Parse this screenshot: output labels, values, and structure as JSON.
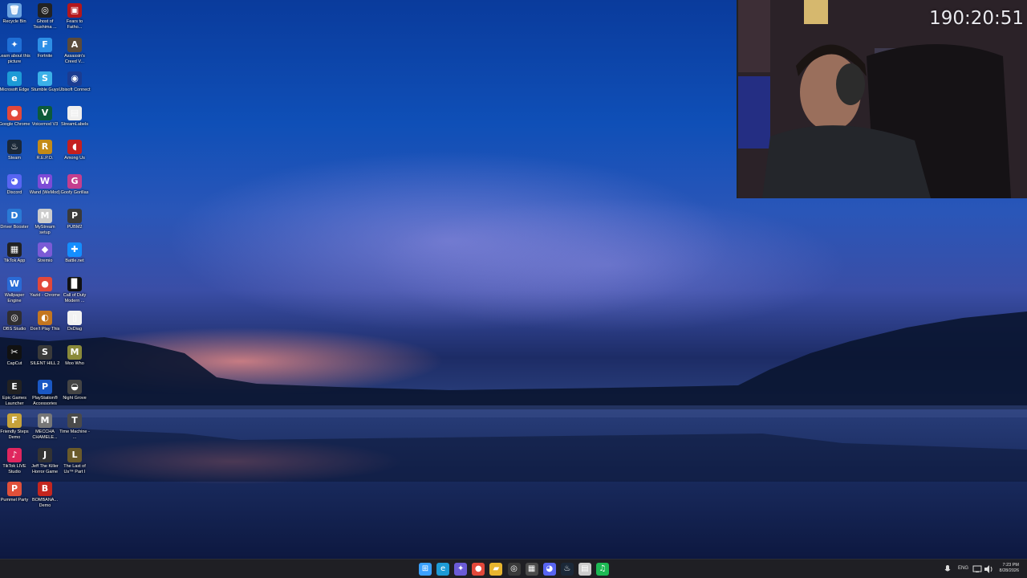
{
  "desktop": {
    "icons": [
      {
        "label": "Recycle Bin",
        "glyph": "🗑",
        "color": "#6aa3e0"
      },
      {
        "label": "Ghost of Tsushima ...",
        "glyph": "◎",
        "color": "#222222"
      },
      {
        "label": "Fears to Fatho...",
        "glyph": "▣",
        "color": "#b3171c"
      },
      {
        "label": "Learn about this picture",
        "glyph": "✦",
        "color": "#1f6fd6"
      },
      {
        "label": "Fortnite",
        "glyph": "F",
        "color": "#2d8fe6"
      },
      {
        "label": "Assassin's Creed V...",
        "glyph": "A",
        "color": "#5a4a3a"
      },
      {
        "label": "Microsoft Edge",
        "glyph": "e",
        "color": "#1d9bd6"
      },
      {
        "label": "Stumble Guys",
        "glyph": "S",
        "color": "#3bb1e8"
      },
      {
        "label": "Ubisoft Connect",
        "glyph": "◉",
        "color": "#1b3c91"
      },
      {
        "label": "Google Chrome",
        "glyph": "●",
        "color": "#e2483a"
      },
      {
        "label": "Voicemod V3",
        "glyph": "V",
        "color": "#0c5a3a"
      },
      {
        "label": "StreamLabels",
        "glyph": "▤",
        "color": "#eeeeee"
      },
      {
        "label": "Steam",
        "glyph": "♨",
        "color": "#1b2838"
      },
      {
        "label": "R.E.P.O.",
        "glyph": "R",
        "color": "#c38a17"
      },
      {
        "label": "Among Us",
        "glyph": "◖",
        "color": "#c41f1f"
      },
      {
        "label": "Discord",
        "glyph": "◕",
        "color": "#5865f2"
      },
      {
        "label": "Wand (WeMod)",
        "glyph": "W",
        "color": "#7d4bd6"
      },
      {
        "label": "Goofy Gorillas",
        "glyph": "G",
        "color": "#c43e8e"
      },
      {
        "label": "Driver Booster",
        "glyph": "D",
        "color": "#2a7ad6"
      },
      {
        "label": "MyStream setup",
        "glyph": "M",
        "color": "#cccccc"
      },
      {
        "label": "PUBM2",
        "glyph": "P",
        "color": "#3a3a3a"
      },
      {
        "label": "TikTok App",
        "glyph": "▦",
        "color": "#222222"
      },
      {
        "label": "Stremio",
        "glyph": "◆",
        "color": "#7b5bd6"
      },
      {
        "label": "Battle.net",
        "glyph": "✚",
        "color": "#148eff"
      },
      {
        "label": "Wallpaper Engine",
        "glyph": "W",
        "color": "#2a6bd6"
      },
      {
        "label": "Yazid - Chrome",
        "glyph": "●",
        "color": "#e2483a"
      },
      {
        "label": "Call of Duty Modern ...",
        "glyph": "▉",
        "color": "#111111"
      },
      {
        "label": "OBS Studio",
        "glyph": "◎",
        "color": "#302e31"
      },
      {
        "label": "Don't Play This",
        "glyph": "◐",
        "color": "#c4761f"
      },
      {
        "label": "DxDiag",
        "glyph": "▯",
        "color": "#f2f2f2"
      },
      {
        "label": "CapCut",
        "glyph": "✂",
        "color": "#111111"
      },
      {
        "label": "SILENT HILL 2",
        "glyph": "S",
        "color": "#3a3a3a"
      },
      {
        "label": "Moo Who",
        "glyph": "M",
        "color": "#8a8a3a"
      },
      {
        "label": "Epic Games Launcher",
        "glyph": "E",
        "color": "#222222"
      },
      {
        "label": "PlayStation® Accessories",
        "glyph": "P",
        "color": "#1a58c4"
      },
      {
        "label": "Night Grove",
        "glyph": "◒",
        "color": "#444444"
      },
      {
        "label": "Friendly Steps Demo",
        "glyph": "F",
        "color": "#c6a23a"
      },
      {
        "label": "MECCHA CHAMELE...",
        "glyph": "M",
        "color": "#777777"
      },
      {
        "label": "Time Machine - ...",
        "glyph": "T",
        "color": "#4a4a4a"
      },
      {
        "label": "TikTok LIVE Studio",
        "glyph": "♪",
        "color": "#e0265e"
      },
      {
        "label": "Jeff The Killer Horror Game",
        "glyph": "J",
        "color": "#333333"
      },
      {
        "label": "The Last of Us™ Part I",
        "glyph": "L",
        "color": "#6a5a2a"
      },
      {
        "label": "Pummel Party",
        "glyph": "P",
        "color": "#e0503a"
      },
      {
        "label": "BOMBANA... Demo",
        "glyph": "B",
        "color": "#c4261f"
      }
    ]
  },
  "stream": {
    "timer": "190:20:51"
  },
  "taskbar": {
    "apps": [
      {
        "name": "start-button",
        "glyph": "⊞",
        "color": "#3aa0ff"
      },
      {
        "name": "edge-taskbar-icon",
        "glyph": "e",
        "color": "#1d9bd6"
      },
      {
        "name": "copilot-taskbar-icon",
        "glyph": "✦",
        "color": "#6b5bd6"
      },
      {
        "name": "chrome-taskbar-icon",
        "glyph": "●",
        "color": "#e2483a"
      },
      {
        "name": "file-explorer-taskbar-icon",
        "glyph": "▰",
        "color": "#e8b52e"
      },
      {
        "name": "obs-taskbar-icon",
        "glyph": "◎",
        "color": "#3a3a3a"
      },
      {
        "name": "app-taskbar-icon",
        "glyph": "▦",
        "color": "#4a4a4a"
      },
      {
        "name": "discord-taskbar-icon",
        "glyph": "◕",
        "color": "#5865f2"
      },
      {
        "name": "steam-taskbar-icon",
        "glyph": "♨",
        "color": "#1b2838"
      },
      {
        "name": "streamlabels-taskbar-icon",
        "glyph": "▤",
        "color": "#cccccc"
      },
      {
        "name": "spotify-taskbar-icon",
        "glyph": "♫",
        "color": "#1db954"
      }
    ],
    "tray": {
      "language": "ENG",
      "time": "7:23 PM",
      "date": "8/28/2026"
    }
  }
}
